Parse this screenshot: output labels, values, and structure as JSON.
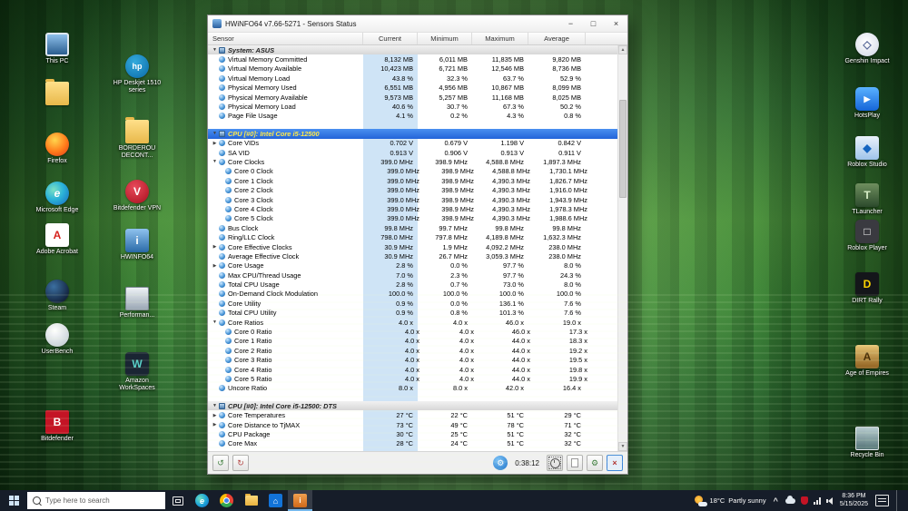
{
  "colors": {
    "current_column_highlight": "#cfe4f6",
    "selected_row": "#2a6ee0",
    "selected_row_text": "#ffe94a",
    "taskbar_background": "#161d29"
  },
  "window": {
    "title": "HWiNFO64 v7.66-5271 - Sensors Status",
    "controls": {
      "minimize": "−",
      "maximize": "□",
      "close": "×"
    },
    "columns": [
      "Sensor",
      "Current",
      "Minimum",
      "Maximum",
      "Average"
    ],
    "statusbar": {
      "timer": "0:38:12"
    },
    "rows": [
      {
        "t": "g",
        "label": "System: ASUS",
        "exp": "down"
      },
      {
        "t": "d",
        "label": "Virtual Memory Committed",
        "v": [
          "8,132 MB",
          "6,011 MB",
          "11,835 MB",
          "9,820 MB"
        ]
      },
      {
        "t": "d",
        "label": "Virtual Memory Available",
        "v": [
          "10,423 MB",
          "6,721 MB",
          "12,546 MB",
          "8,736 MB"
        ]
      },
      {
        "t": "d",
        "label": "Virtual Memory Load",
        "v": [
          "43.8 %",
          "32.3 %",
          "63.7 %",
          "52.9 %"
        ]
      },
      {
        "t": "d",
        "label": "Physical Memory Used",
        "v": [
          "6,551 MB",
          "4,956 MB",
          "10,867 MB",
          "8,099 MB"
        ]
      },
      {
        "t": "d",
        "label": "Physical Memory Available",
        "v": [
          "9,573 MB",
          "5,257 MB",
          "11,168 MB",
          "8,025 MB"
        ]
      },
      {
        "t": "d",
        "label": "Physical Memory Load",
        "v": [
          "40.6 %",
          "30.7 %",
          "67.3 %",
          "50.2 %"
        ]
      },
      {
        "t": "d",
        "label": "Page File Usage",
        "v": [
          "4.1 %",
          "0.2 %",
          "4.3 %",
          "0.8 %"
        ]
      },
      {
        "t": "sp"
      },
      {
        "t": "g",
        "label": "CPU [#0]: Intel Core i5-12500",
        "exp": "down",
        "sel": true
      },
      {
        "t": "d",
        "label": "Core VIDs",
        "exp": "right",
        "v": [
          "0.702 V",
          "0.679 V",
          "1.198 V",
          "0.842 V"
        ]
      },
      {
        "t": "d",
        "label": "SA VID",
        "v": [
          "0.913 V",
          "0.906 V",
          "0.913 V",
          "0.911 V"
        ]
      },
      {
        "t": "d",
        "label": "Core Clocks",
        "exp": "down",
        "v": [
          "399.0 MHz",
          "398.9 MHz",
          "4,588.8 MHz",
          "1,897.3 MHz"
        ]
      },
      {
        "t": "d",
        "ind": 1,
        "label": "Core 0 Clock",
        "v": [
          "399.0 MHz",
          "398.9 MHz",
          "4,588.8 MHz",
          "1,730.1 MHz"
        ]
      },
      {
        "t": "d",
        "ind": 1,
        "label": "Core 1 Clock",
        "v": [
          "399.0 MHz",
          "398.9 MHz",
          "4,390.3 MHz",
          "1,826.7 MHz"
        ]
      },
      {
        "t": "d",
        "ind": 1,
        "label": "Core 2 Clock",
        "v": [
          "399.0 MHz",
          "398.9 MHz",
          "4,390.3 MHz",
          "1,916.0 MHz"
        ]
      },
      {
        "t": "d",
        "ind": 1,
        "label": "Core 3 Clock",
        "v": [
          "399.0 MHz",
          "398.9 MHz",
          "4,390.3 MHz",
          "1,943.9 MHz"
        ]
      },
      {
        "t": "d",
        "ind": 1,
        "label": "Core 4 Clock",
        "v": [
          "399.0 MHz",
          "398.9 MHz",
          "4,390.3 MHz",
          "1,978.3 MHz"
        ]
      },
      {
        "t": "d",
        "ind": 1,
        "label": "Core 5 Clock",
        "v": [
          "399.0 MHz",
          "398.9 MHz",
          "4,390.3 MHz",
          "1,988.6 MHz"
        ]
      },
      {
        "t": "d",
        "label": "Bus Clock",
        "v": [
          "99.8 MHz",
          "99.7 MHz",
          "99.8 MHz",
          "99.8 MHz"
        ]
      },
      {
        "t": "d",
        "label": "Ring/LLC Clock",
        "v": [
          "798.0 MHz",
          "797.8 MHz",
          "4,189.8 MHz",
          "1,632.3 MHz"
        ]
      },
      {
        "t": "d",
        "label": "Core Effective Clocks",
        "exp": "right",
        "v": [
          "30.9 MHz",
          "1.9 MHz",
          "4,092.2 MHz",
          "238.0 MHz"
        ]
      },
      {
        "t": "d",
        "label": "Average Effective Clock",
        "v": [
          "30.9 MHz",
          "26.7 MHz",
          "3,059.3 MHz",
          "238.0 MHz"
        ]
      },
      {
        "t": "d",
        "label": "Core Usage",
        "exp": "right",
        "v": [
          "2.8 %",
          "0.0 %",
          "97.7 %",
          "8.0 %"
        ]
      },
      {
        "t": "d",
        "label": "Max CPU/Thread Usage",
        "v": [
          "7.0 %",
          "2.3 %",
          "97.7 %",
          "24.3 %"
        ]
      },
      {
        "t": "d",
        "label": "Total CPU Usage",
        "v": [
          "2.8 %",
          "0.7 %",
          "73.0 %",
          "8.0 %"
        ]
      },
      {
        "t": "d",
        "label": "On-Demand Clock Modulation",
        "v": [
          "100.0 %",
          "100.0 %",
          "100.0 %",
          "100.0 %"
        ]
      },
      {
        "t": "d",
        "label": "Core Utility",
        "v": [
          "0.9 %",
          "0.0 %",
          "136.1 %",
          "7.6 %"
        ]
      },
      {
        "t": "d",
        "label": "Total CPU Utility",
        "v": [
          "0.9 %",
          "0.8 %",
          "101.3 %",
          "7.6 %"
        ]
      },
      {
        "t": "d",
        "label": "Core Ratios",
        "exp": "down",
        "v": [
          "4.0 x",
          "4.0 x",
          "46.0 x",
          "19.0 x"
        ]
      },
      {
        "t": "d",
        "ind": 1,
        "label": "Core 0 Ratio",
        "v": [
          "4.0 x",
          "4.0 x",
          "46.0 x",
          "17.3 x"
        ]
      },
      {
        "t": "d",
        "ind": 1,
        "label": "Core 1 Ratio",
        "v": [
          "4.0 x",
          "4.0 x",
          "44.0 x",
          "18.3 x"
        ]
      },
      {
        "t": "d",
        "ind": 1,
        "label": "Core 2 Ratio",
        "v": [
          "4.0 x",
          "4.0 x",
          "44.0 x",
          "19.2 x"
        ]
      },
      {
        "t": "d",
        "ind": 1,
        "label": "Core 3 Ratio",
        "v": [
          "4.0 x",
          "4.0 x",
          "44.0 x",
          "19.5 x"
        ]
      },
      {
        "t": "d",
        "ind": 1,
        "label": "Core 4 Ratio",
        "v": [
          "4.0 x",
          "4.0 x",
          "44.0 x",
          "19.8 x"
        ]
      },
      {
        "t": "d",
        "ind": 1,
        "label": "Core 5 Ratio",
        "v": [
          "4.0 x",
          "4.0 x",
          "44.0 x",
          "19.9 x"
        ]
      },
      {
        "t": "d",
        "label": "Uncore Ratio",
        "v": [
          "8.0 x",
          "8.0 x",
          "42.0 x",
          "16.4 x"
        ]
      },
      {
        "t": "sp"
      },
      {
        "t": "g",
        "label": "CPU [#0]: Intel Core i5-12500: DTS",
        "exp": "down"
      },
      {
        "t": "d",
        "label": "Core Temperatures",
        "exp": "right",
        "v": [
          "27 °C",
          "22 °C",
          "51 °C",
          "29 °C"
        ]
      },
      {
        "t": "d",
        "label": "Core Distance to TjMAX",
        "exp": "right",
        "v": [
          "73 °C",
          "49 °C",
          "78 °C",
          "71 °C"
        ]
      },
      {
        "t": "d",
        "label": "CPU Package",
        "v": [
          "30 °C",
          "25 °C",
          "51 °C",
          "32 °C"
        ]
      },
      {
        "t": "d",
        "label": "Core Max",
        "v": [
          "28 °C",
          "24 °C",
          "51 °C",
          "32 °C"
        ]
      }
    ]
  },
  "desktop": {
    "left_col1": [
      {
        "label": "This PC",
        "icon": "this-pc"
      },
      {
        "label": "",
        "icon": "folder"
      },
      {
        "label": "Firefox",
        "icon": "firefox"
      },
      {
        "label": "Microsoft Edge",
        "icon": "edge"
      },
      {
        "label": "Adobe Acrobat",
        "icon": "acrobat"
      },
      {
        "label": "Steam",
        "icon": "steam"
      },
      {
        "label": "UserBench",
        "icon": "userbench"
      },
      {
        "label": "Bitdefender",
        "icon": "bitdefender"
      }
    ],
    "left_col2": [
      {
        "label": "HP Deskjet 1510 series",
        "icon": "hp"
      },
      {
        "label": "BORDEROU DECONT...",
        "icon": "folder"
      },
      {
        "label": "Bitdefender VPN",
        "icon": "bvpn"
      },
      {
        "label": "HWINFO64",
        "icon": "hwinfo"
      },
      {
        "label": "Performan...",
        "icon": "perf"
      },
      {
        "label": "Amazon WorkSpaces",
        "icon": "aws"
      }
    ],
    "right_col": [
      {
        "label": "Genshin Impact",
        "icon": "genshin"
      },
      {
        "label": "HotsPlay",
        "icon": "hotsplay"
      },
      {
        "label": "Roblox Studio",
        "icon": "rstudio"
      },
      {
        "label": "TLauncher",
        "icon": "tlauncher"
      },
      {
        "label": "Roblox Player",
        "icon": "rplayer"
      },
      {
        "label": "DIRT Rally",
        "icon": "dirt"
      },
      {
        "label": "Age of Empires",
        "icon": "aoe"
      },
      {
        "label": "Recycle Bin",
        "icon": "recycle"
      }
    ]
  },
  "icon_glyphs": {
    "edge": "e",
    "acrobat": "A",
    "bitdefender": "B",
    "hp": "hp",
    "bvpn": "V",
    "hwinfo": "i",
    "aws": "W",
    "genshin": "◇",
    "hotsplay": "▶",
    "rstudio": "◆",
    "tlauncher": "T",
    "rplayer": "□",
    "dirt": "D",
    "aoe": "A",
    "store": "⌂",
    "chrome": "",
    "file-explorer": "",
    "task-view": "",
    "this-pc": "",
    "folder": "",
    "firefox": "",
    "steam": "",
    "userbench": "",
    "perf": "",
    "recycle": ""
  },
  "taskbar": {
    "search_placeholder": "Type here to search",
    "apps": [
      {
        "name": "task-view",
        "active": false
      },
      {
        "name": "edge",
        "active": false
      },
      {
        "name": "chrome",
        "active": false
      },
      {
        "name": "file-explorer",
        "active": false
      },
      {
        "name": "store",
        "active": false
      },
      {
        "name": "hwinfo",
        "active": true
      }
    ],
    "tray": {
      "weather_temp": "18°C",
      "weather_desc": "Partly sunny",
      "caret": "^",
      "time": "8:36 PM",
      "date": "5/15/2025"
    }
  }
}
